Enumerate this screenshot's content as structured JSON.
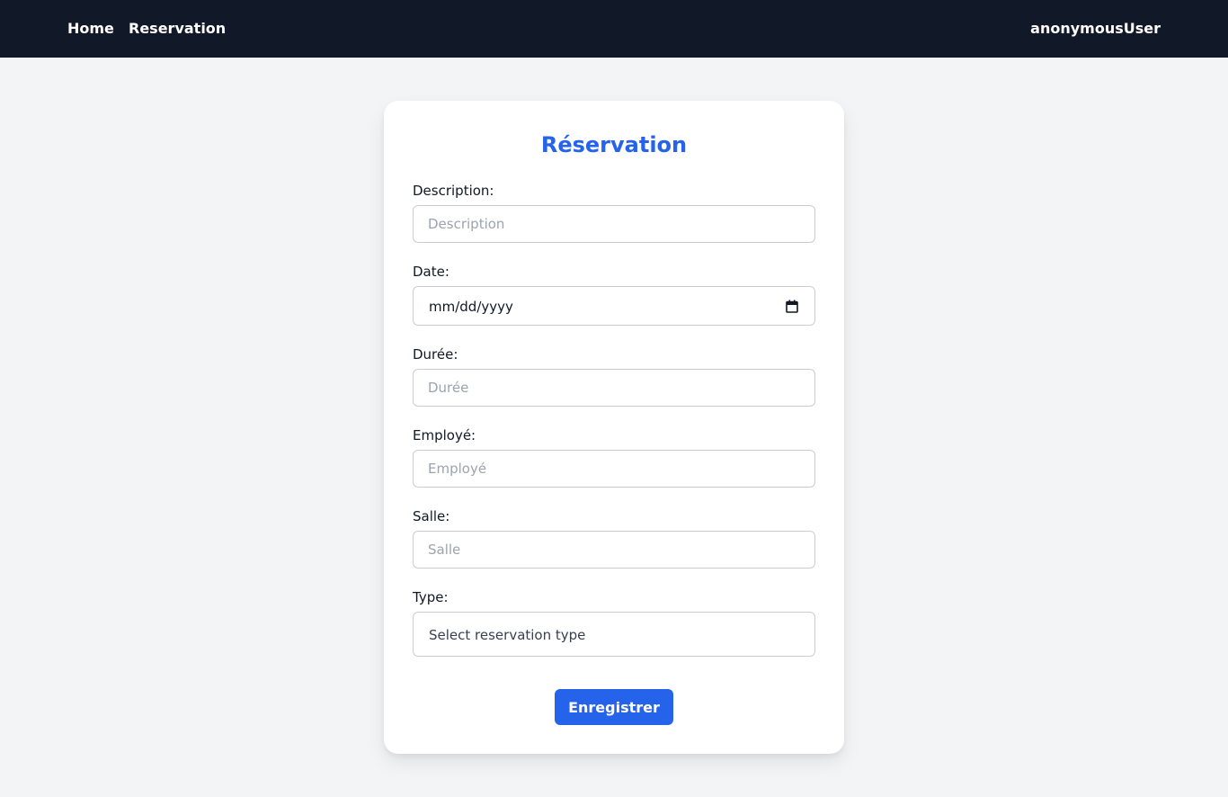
{
  "nav": {
    "home": "Home",
    "reservation": "Reservation",
    "user": "anonymousUser"
  },
  "form": {
    "title": "Réservation",
    "description": {
      "label": "Description:",
      "placeholder": "Description"
    },
    "date": {
      "label": "Date:",
      "value": "mm/dd/yyyy"
    },
    "duree": {
      "label": "Durée:",
      "placeholder": "Durée"
    },
    "employe": {
      "label": "Employé:",
      "placeholder": "Employé"
    },
    "salle": {
      "label": "Salle:",
      "placeholder": "Salle"
    },
    "type": {
      "label": "Type:",
      "selected": "Select reservation type"
    },
    "submit": "Enregistrer"
  },
  "colors": {
    "navbar_bg": "#111827",
    "page_bg": "#f3f4f6",
    "accent": "#2563eb"
  },
  "icons": {
    "date_picker": "calendar-icon"
  }
}
